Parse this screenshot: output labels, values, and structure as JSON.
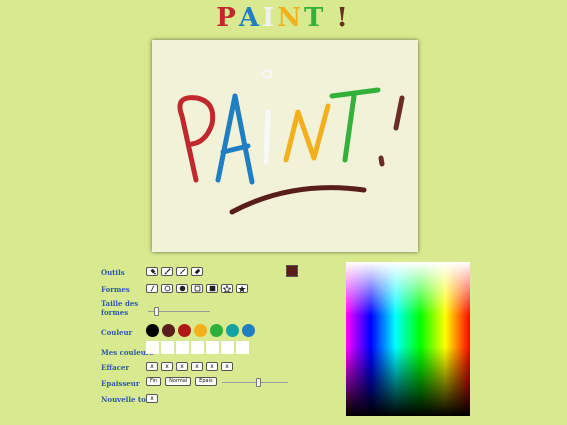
{
  "title": {
    "letters": [
      {
        "ch": "P",
        "color": "#c0282d"
      },
      {
        "ch": "A",
        "color": "#1f7fc2"
      },
      {
        "ch": "I",
        "color": "#f0f0f0"
      },
      {
        "ch": "N",
        "color": "#f2b01d"
      },
      {
        "ch": "T",
        "color": "#34b13a"
      },
      {
        "ch": " ",
        "color": "#000000"
      },
      {
        "ch": "!",
        "color": "#6b2c24"
      }
    ]
  },
  "labels": {
    "tools": "Outils",
    "shapes": "Formes",
    "size_line1": "Taille des",
    "size_line2": "formes",
    "color": "Couleur",
    "my_colors": "Mes couleurs",
    "erase": "Effacer",
    "thickness": "Epaisseur",
    "new_canvas": "Nouvelle toile"
  },
  "tools": [
    "bucket-icon",
    "brush-icon",
    "pencil-icon",
    "eraser-icon"
  ],
  "shapes": [
    "line-icon",
    "circle-icon",
    "filled-circle-icon",
    "square-icon",
    "filled-square-icon",
    "star-icon",
    "filled-star-icon"
  ],
  "palette": [
    "#000000",
    "#5a1e1a",
    "#b01818",
    "#f2b01d",
    "#2db13a",
    "#14a3a3",
    "#1f7fc2"
  ],
  "my_colors_count": 7,
  "erase": {
    "label": "x",
    "count": 6
  },
  "thickness": {
    "fin": "Fin",
    "normal": "Normal",
    "epais": "Epais",
    "level": 0.55
  },
  "shape_size": {
    "level": 0.1
  },
  "new_canvas_button": "x",
  "current_color": "#5a1e1a"
}
